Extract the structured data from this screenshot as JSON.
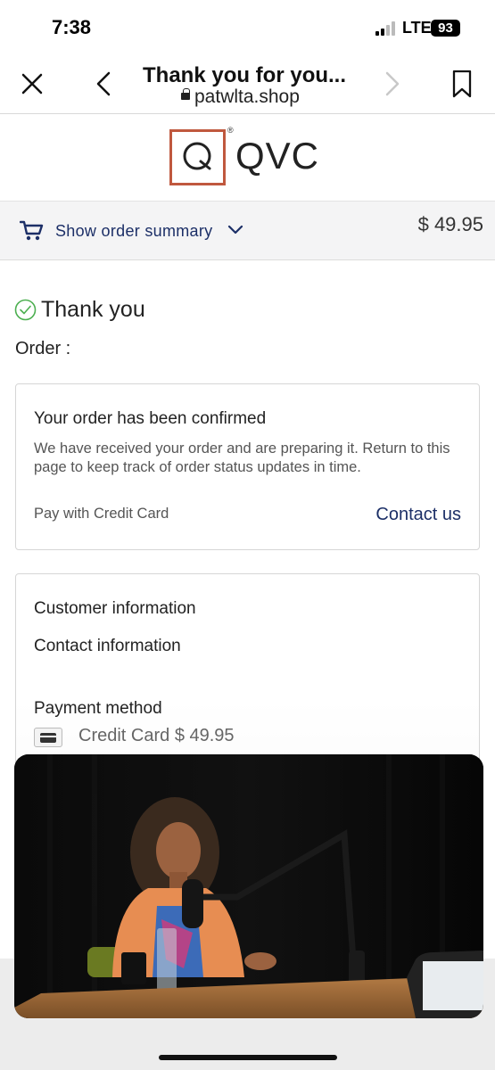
{
  "status_bar": {
    "time": "7:38",
    "network": "LTE",
    "battery": "93"
  },
  "browser": {
    "title": "Thank you for you...",
    "url": "patwlta.shop"
  },
  "logo": {
    "text": "QVC",
    "mark": "Q",
    "registered": "®"
  },
  "order_summary": {
    "label": "Show order summary",
    "total": "$ 49.95"
  },
  "thank_you": {
    "heading": "Thank you",
    "order_label": "Order :"
  },
  "confirmation": {
    "title": "Your order has been confirmed",
    "body": "We have received your order and are preparing it. Return to this page to keep track of order status updates in time.",
    "payment_note": "Pay with Credit Card",
    "contact_link": "Contact us"
  },
  "customer": {
    "title": "Customer information",
    "contact_heading": "Contact information",
    "payment_heading": "Payment method",
    "payment_value": "Credit Card $ 49.95"
  },
  "colors": {
    "accent": "#1c2f67",
    "logo_box": "#c0583e",
    "check": "#4caf50"
  }
}
